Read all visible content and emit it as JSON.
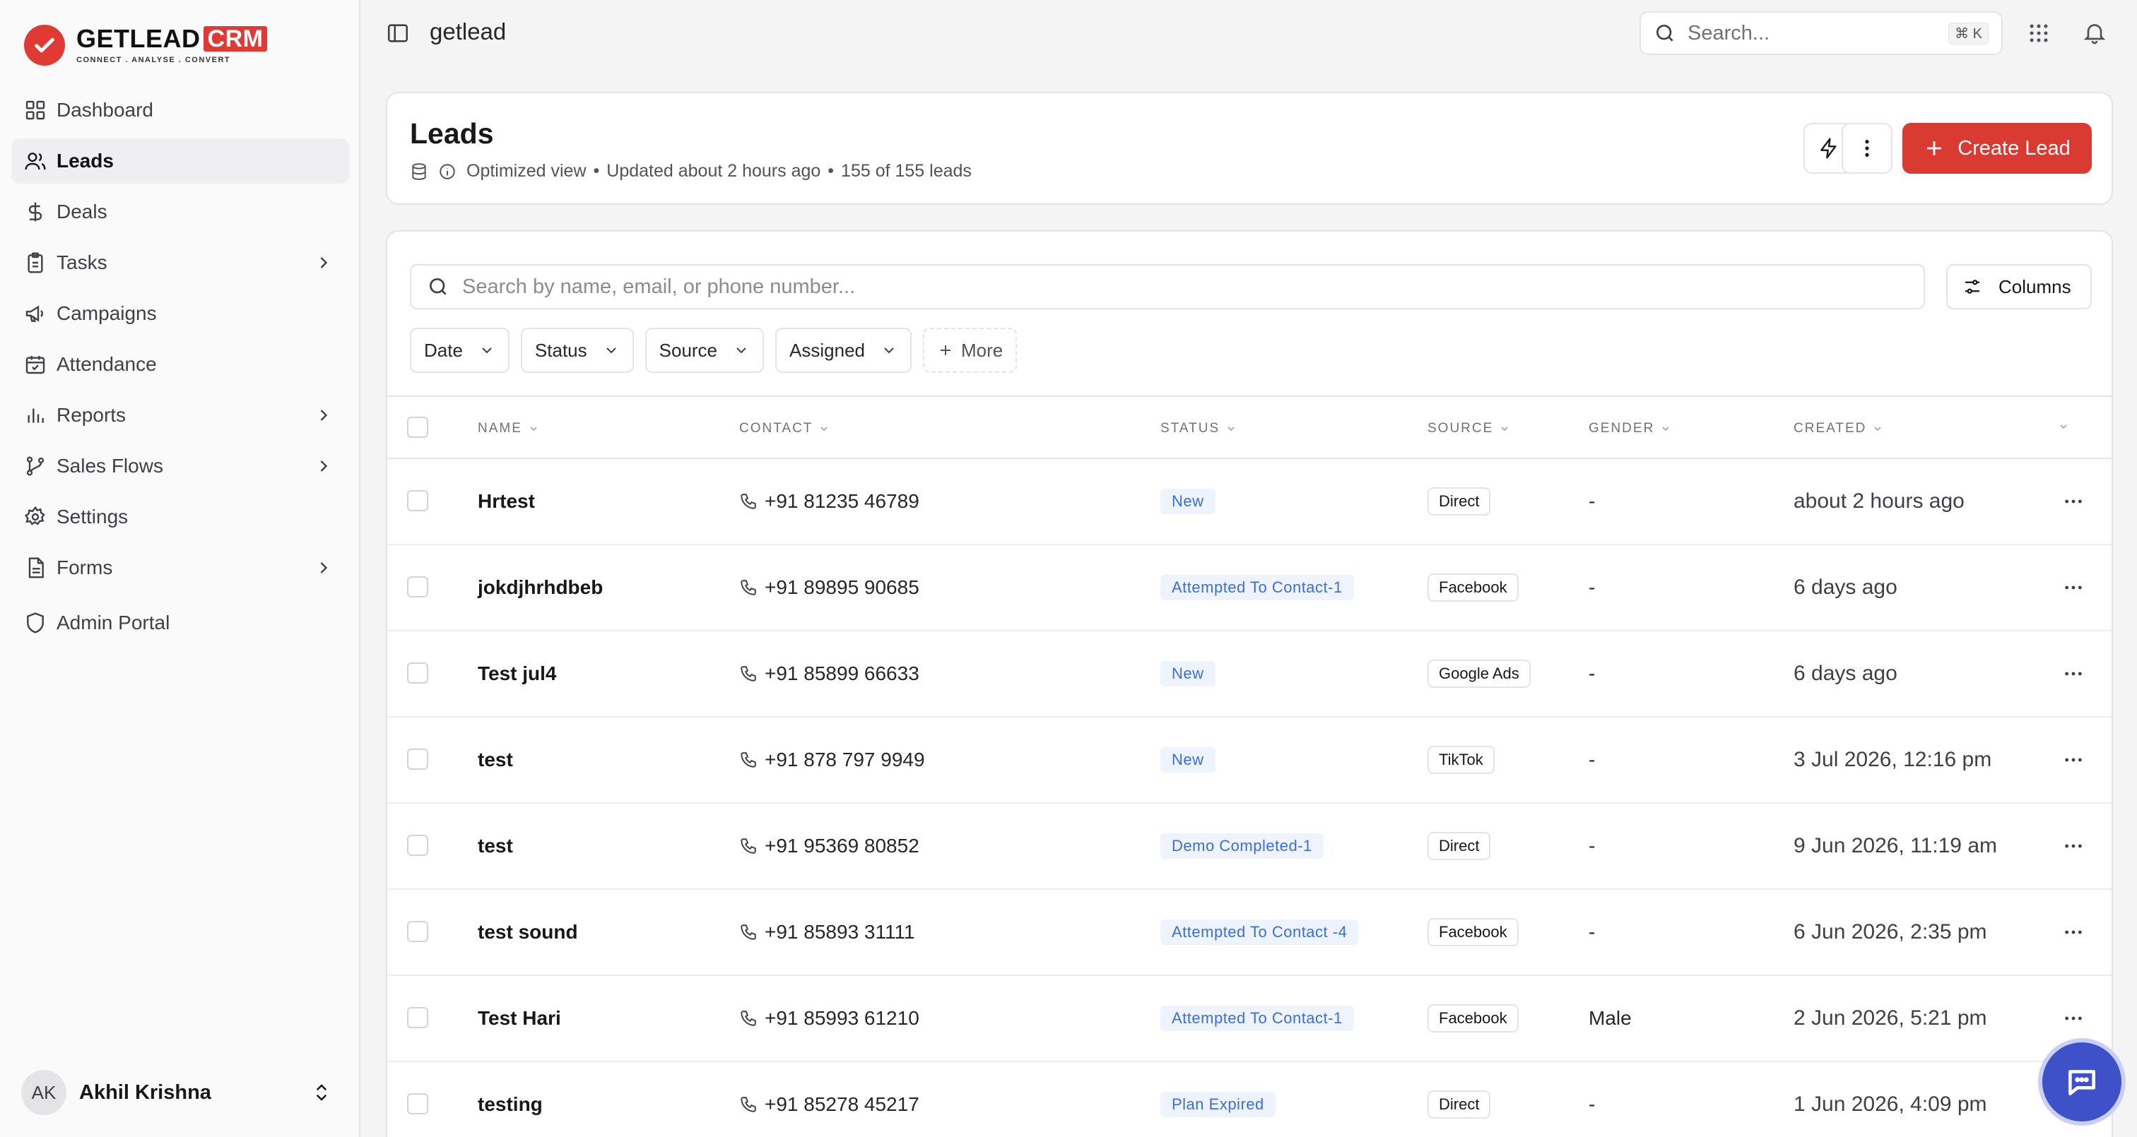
{
  "brand": {
    "name": "GETLEAD",
    "suffix": "CRM",
    "tagline": "CONNECT  .  ANALYSE  .  CONVERT"
  },
  "sidebar": {
    "items": [
      {
        "label": "Dashboard"
      },
      {
        "label": "Leads"
      },
      {
        "label": "Deals"
      },
      {
        "label": "Tasks"
      },
      {
        "label": "Campaigns"
      },
      {
        "label": "Attendance"
      },
      {
        "label": "Reports"
      },
      {
        "label": "Sales Flows"
      },
      {
        "label": "Settings"
      },
      {
        "label": "Forms"
      },
      {
        "label": "Admin Portal"
      }
    ],
    "user": {
      "initials": "AK",
      "name": "Akhil Krishna"
    }
  },
  "topbar": {
    "workspace": "getlead",
    "search_placeholder": "Search...",
    "shortcut": "⌘ K"
  },
  "header": {
    "title": "Leads",
    "view": "Optimized view",
    "updated": "Updated about 2 hours ago",
    "count": "155 of 155 leads",
    "create_label": "Create Lead"
  },
  "toolbar": {
    "search_placeholder": "Search by name, email, or phone number...",
    "columns_label": "Columns",
    "filters": [
      "Date",
      "Status",
      "Source",
      "Assigned"
    ],
    "more_label": "More"
  },
  "table": {
    "columns": [
      "NAME",
      "CONTACT",
      "STATUS",
      "SOURCE",
      "GENDER",
      "CREATED"
    ],
    "rows": [
      {
        "name": "Hrtest",
        "contact": "+91 81235 46789",
        "status": "New",
        "source": "Direct",
        "gender": "-",
        "created": "about 2 hours ago"
      },
      {
        "name": "jokdjhrhdbeb",
        "contact": "+91 89895 90685",
        "status": "Attempted To Contact-1",
        "source": "Facebook",
        "gender": "-",
        "created": "6 days ago"
      },
      {
        "name": "Test jul4",
        "contact": "+91 85899 66633",
        "status": "New",
        "source": "Google Ads",
        "gender": "-",
        "created": "6 days ago"
      },
      {
        "name": "test",
        "contact": "+91 878 797 9949",
        "status": "New",
        "source": "TikTok",
        "gender": "-",
        "created": "3 Jul 2026, 12:16 pm"
      },
      {
        "name": "test",
        "contact": "+91 95369 80852",
        "status": "Demo Completed-1",
        "source": "Direct",
        "gender": "-",
        "created": "9 Jun 2026, 11:19 am"
      },
      {
        "name": "test sound",
        "contact": "+91 85893 31111",
        "status": "Attempted To Contact -4",
        "source": "Facebook",
        "gender": "-",
        "created": "6 Jun 2026, 2:35 pm"
      },
      {
        "name": "Test Hari",
        "contact": "+91 85993 61210",
        "status": "Attempted To Contact-1",
        "source": "Facebook",
        "gender": "Male",
        "created": "2 Jun 2026, 5:21 pm"
      },
      {
        "name": "testing",
        "contact": "+91 85278 45217",
        "status": "Plan Expired",
        "source": "Direct",
        "gender": "-",
        "created": "1 Jun 2026, 4:09 pm"
      }
    ]
  },
  "colors": {
    "accent": "#d93a31",
    "status_badge_bg": "#eef3fd",
    "status_badge_text": "#3b6fd8",
    "chat_fab": "#3f51c8"
  }
}
